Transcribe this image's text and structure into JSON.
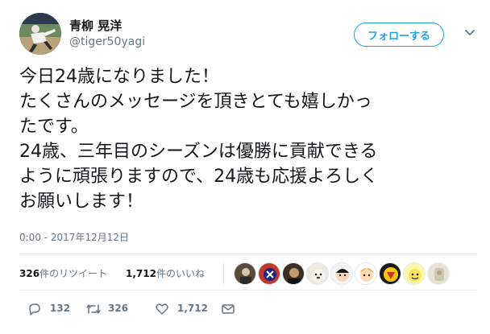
{
  "user": {
    "display_name": "青柳 晃洋",
    "handle": "@tiger50yagi"
  },
  "follow_button": {
    "label": "フォローする"
  },
  "tweet": {
    "lines": [
      "今日24歳になりました！",
      "たくさんのメッセージを頂きとても嬉しかっ",
      "たです。",
      "24歳、三年目のシーズンは優勝に貢献できる",
      "ように頑張りますので、24歳も応援よろしく",
      "お願いします！"
    ],
    "timestamp": "0:00 - 2017年12月12日"
  },
  "stats": {
    "retweets_count": "326",
    "retweets_label": "件のリツイート",
    "likes_count": "1,712",
    "likes_label": "件のいいね"
  },
  "actions": {
    "reply_count": "132",
    "retweet_count": "326",
    "like_count": "1,712"
  },
  "colors": {
    "accent": "#1da1f2",
    "muted": "#657786",
    "divider": "#e6ecf0"
  },
  "icons": [
    "chevron-down-icon",
    "reply-icon",
    "retweet-icon",
    "heart-icon",
    "mail-icon"
  ]
}
